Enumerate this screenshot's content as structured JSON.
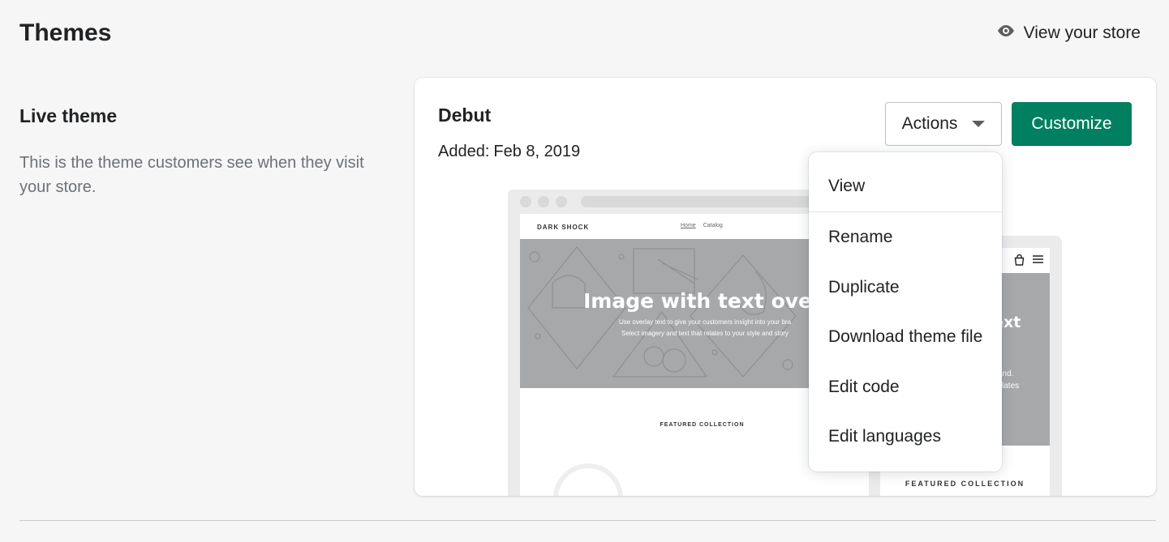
{
  "header": {
    "title": "Themes",
    "view_store_label": "View your store",
    "view_store_icon": "eye-icon"
  },
  "live_section": {
    "title": "Live theme",
    "description": "This is the theme customers see when they visit your store."
  },
  "theme_card": {
    "name": "Debut",
    "added_label": "Added:",
    "added_date": "Feb 8, 2019",
    "actions_label": "Actions",
    "customize_label": "Customize",
    "accent_color": "#008060"
  },
  "preview": {
    "desktop": {
      "brand": "DARK SHOCK",
      "nav": [
        "Home",
        "Catalog"
      ],
      "hero_title": "Image with text overla",
      "hero_sub_1": "Use overlay text to give your customers insight into your bra",
      "hero_sub_2": "Select imagery and text that relates to your style and story",
      "featured": "FEATURED COLLECTION"
    },
    "mobile": {
      "hero_title": "text",
      "hero_sub_1": "your",
      "hero_sub_2": "r brand.",
      "hero_sub_3": "at relates",
      "hero_sub_4": "ry.",
      "featured": "FEATURED COLLECTION"
    }
  },
  "actions_menu": {
    "items": [
      "View",
      "Rename",
      "Duplicate",
      "Download theme file",
      "Edit code",
      "Edit languages"
    ]
  }
}
